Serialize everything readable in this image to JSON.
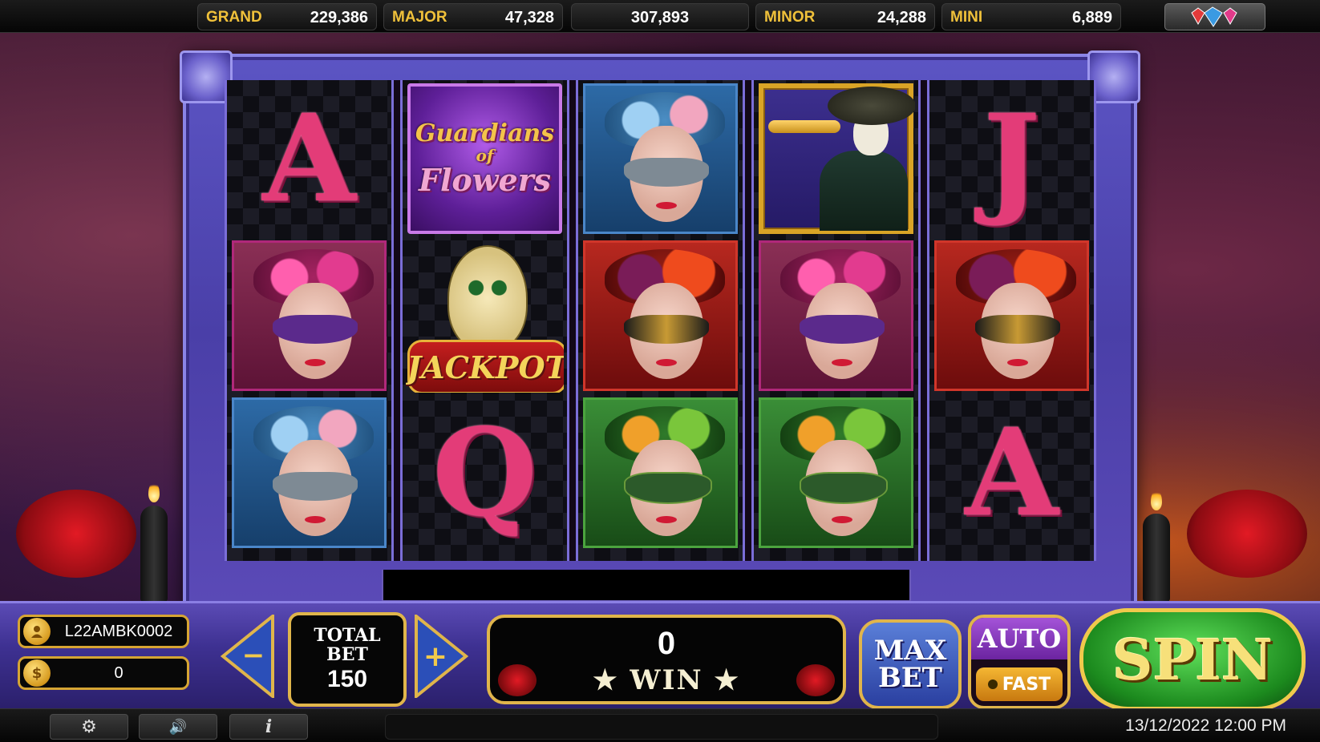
{
  "jackpots": {
    "grand": {
      "label": "GRAND",
      "value": "229,386"
    },
    "major": {
      "label": "MAJOR",
      "value": "47,328"
    },
    "center": {
      "value": "307,893"
    },
    "minor": {
      "label": "MINOR",
      "value": "24,288"
    },
    "mini": {
      "label": "MINI",
      "value": "6,889"
    }
  },
  "reels": [
    [
      "card-A",
      "lady-pink",
      "lady-blue"
    ],
    [
      "logo",
      "jackpot",
      "card-Q"
    ],
    [
      "lady-blue",
      "lady-red",
      "lady-green"
    ],
    [
      "mariachi",
      "lady-pink",
      "lady-green"
    ],
    [
      "card-J",
      "lady-red",
      "card-A"
    ]
  ],
  "symbols": {
    "card_a": "A",
    "card_q": "Q",
    "card_j": "J",
    "logo": {
      "line1": "Guardians",
      "line2": "of",
      "line3": "Flowers"
    },
    "jackpot": "JACKPOT"
  },
  "player": {
    "username": "L22AMBK0002",
    "balance": "0",
    "coin_symbol": "$"
  },
  "bet": {
    "label_line1": "TOTAL",
    "label_line2": "BET",
    "value": "150",
    "decrease_symbol": "−",
    "increase_symbol": "+"
  },
  "win": {
    "value": "0",
    "label": "WIN"
  },
  "buttons": {
    "max_bet_line1": "MAX",
    "max_bet_line2": "BET",
    "auto": "AUTO",
    "fast": "FAST",
    "spin": "SPIN"
  },
  "status_bar": {
    "settings_icon": "⚙",
    "sound_icon": "🔊",
    "info_icon": "i",
    "datetime": "13/12/2022 12:00 PM"
  },
  "colors": {
    "accent_gold": "#e0b54b",
    "frame_purple": "#5c55c4",
    "spin_green": "#1c8a1e"
  },
  "icons": [
    "diamond-icon",
    "gear-icon",
    "speaker-icon",
    "info-icon",
    "user-icon",
    "coin-icon"
  ]
}
